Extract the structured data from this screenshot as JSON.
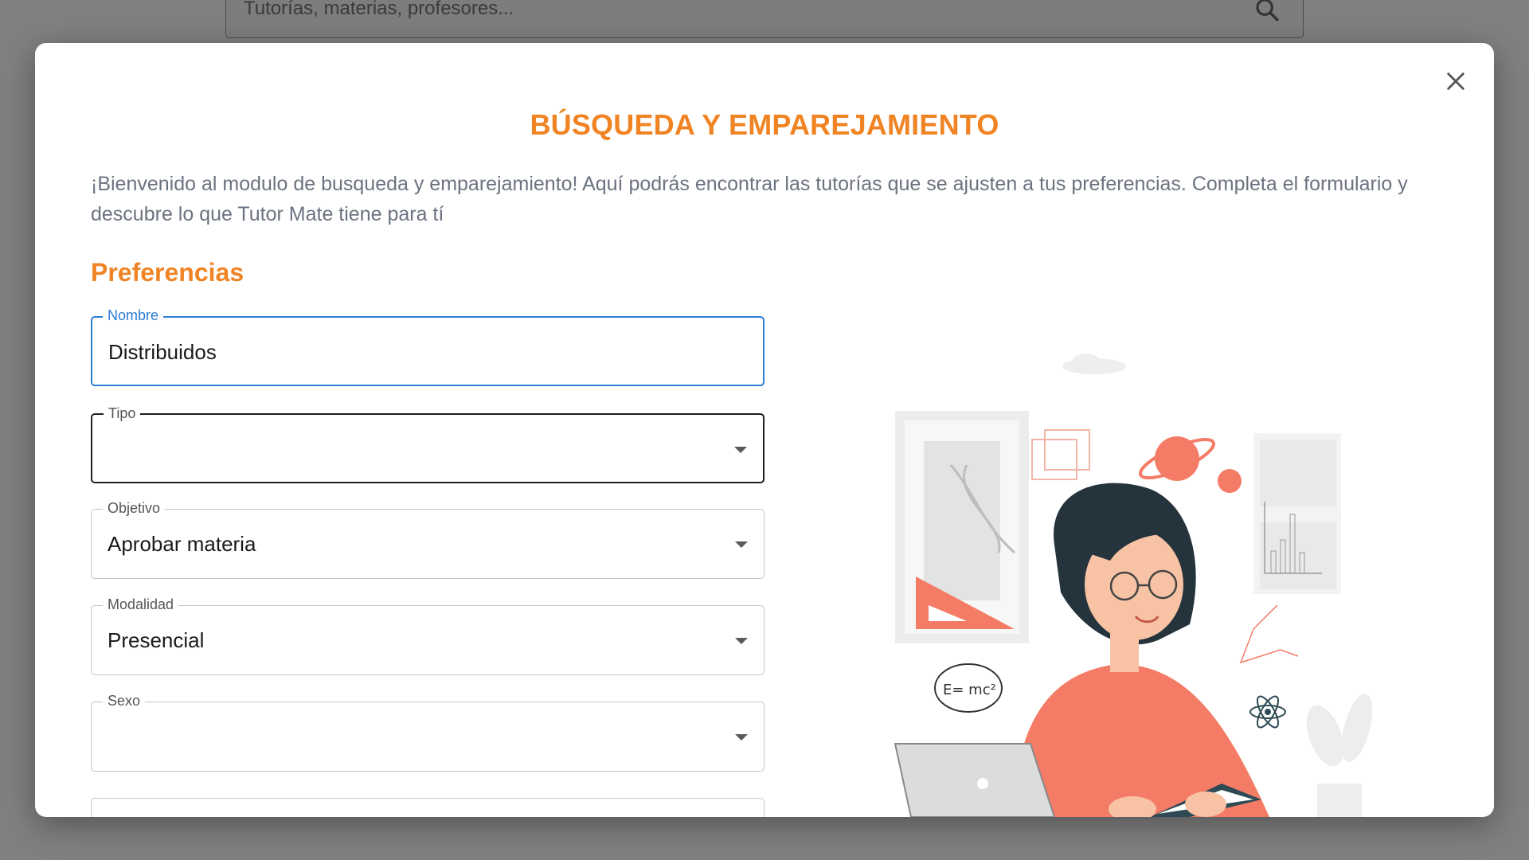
{
  "background": {
    "search_placeholder": "Tutorías, materias, profesores..."
  },
  "modal": {
    "title": "BÚSQUEDA Y EMPAREJAMIENTO",
    "intro": "¡Bienvenido al modulo de busqueda y emparejamiento! Aquí podrás encontrar las tutorías que se ajusten a tus preferencias. Completa el formulario y descubre lo que Tutor Mate tiene para tí",
    "section_title": "Preferencias",
    "fields": {
      "nombre": {
        "label": "Nombre",
        "value": "Distribuidos"
      },
      "tipo": {
        "label": "Tipo",
        "value": ""
      },
      "objetivo": {
        "label": "Objetivo",
        "value": "Aprobar materia"
      },
      "modalidad": {
        "label": "Modalidad",
        "value": "Presencial"
      },
      "sexo": {
        "label": "Sexo",
        "value": ""
      }
    },
    "illustration_formula": "E= mc²"
  },
  "colors": {
    "accent": "#f08424",
    "focus": "#2f7cd3",
    "overlay": "#808080",
    "illustration": "#f47c66"
  },
  "icons": [
    "search-icon",
    "close-icon",
    "chevron-down-icon"
  ]
}
